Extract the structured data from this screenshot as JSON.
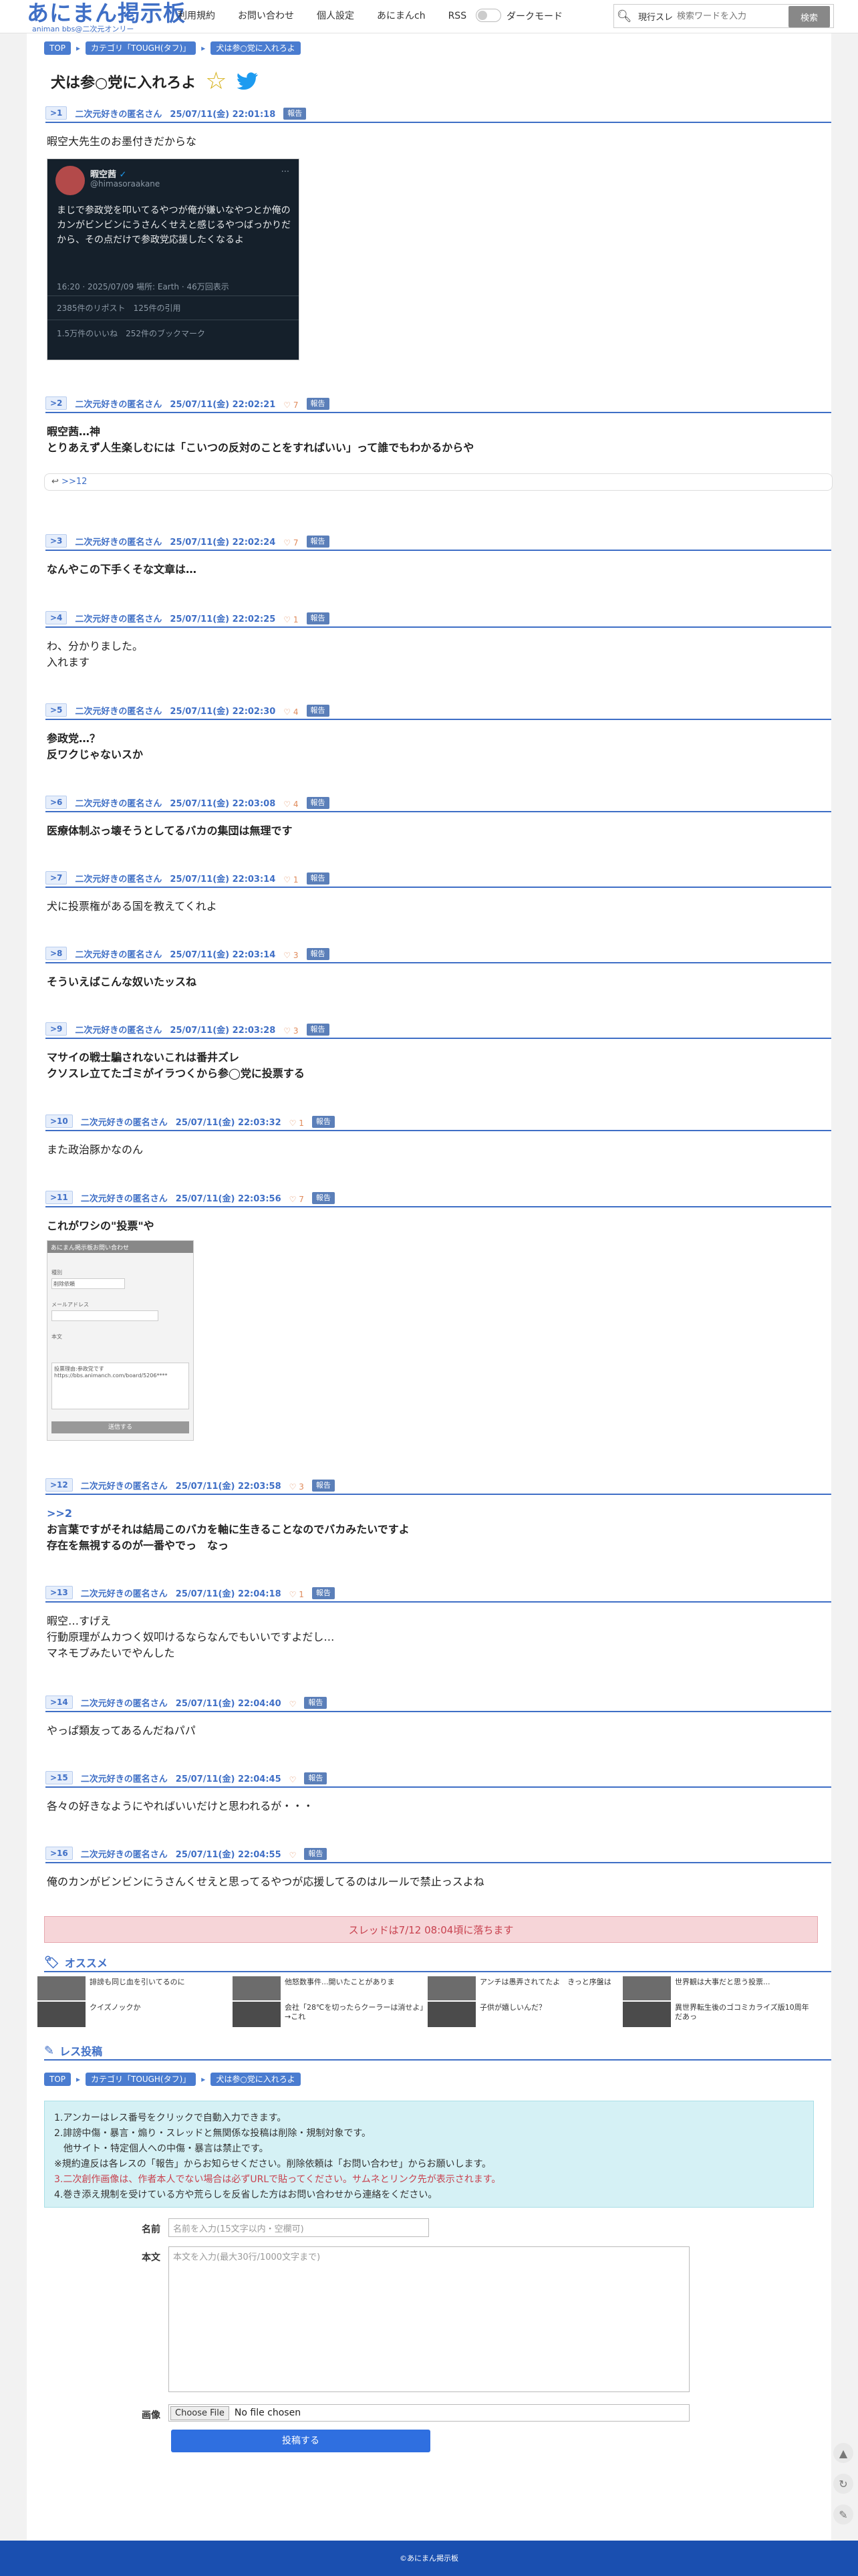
{
  "header": {
    "logo_main": "あにまん掲示板",
    "logo_sub": "animan bbs@二次元オンリー",
    "nav": [
      "利用規約",
      "お問い合わせ",
      "個人設定",
      "あにまんch",
      "RSS"
    ],
    "dark_mode": "ダークモード",
    "search_select": "現行スレ",
    "search_placeholder": "検索ワードを入力",
    "search_button": "検索"
  },
  "breadcrumb": {
    "top": "TOP",
    "category": "カテゴリ「TOUGH(タフ)」",
    "thread": "犬は参○党に入れろよ"
  },
  "thread_title": "犬は参○党に入れろよ",
  "report_label": "報告",
  "posts": [
    {
      "no": ">1",
      "name": "二次元好きの匿名さん",
      "date": "25/07/11(金) 22:01:18",
      "likes": "",
      "lines": [
        "暇空大先生のお墨付きだからな"
      ]
    },
    {
      "no": ">2",
      "name": "二次元好きの匿名さん",
      "date": "25/07/11(金) 22:02:21",
      "likes": "7",
      "lines": [
        "暇空茜…神",
        "とりあえず人生楽しむには「こいつの反対のことをすればいい」って誰でもわかるからや"
      ]
    },
    {
      "no": ">3",
      "name": "二次元好きの匿名さん",
      "date": "25/07/11(金) 22:02:24",
      "likes": "7",
      "lines": [
        "なんやこの下手くそな文章は…"
      ]
    },
    {
      "no": ">4",
      "name": "二次元好きの匿名さん",
      "date": "25/07/11(金) 22:02:25",
      "likes": "1",
      "lines": [
        "わ、分かりました。",
        "入れます"
      ]
    },
    {
      "no": ">5",
      "name": "二次元好きの匿名さん",
      "date": "25/07/11(金) 22:02:30",
      "likes": "4",
      "lines": [
        "参政党…？",
        "反ワクじゃないスか"
      ]
    },
    {
      "no": ">6",
      "name": "二次元好きの匿名さん",
      "date": "25/07/11(金) 22:03:08",
      "likes": "4",
      "lines": [
        "医療体制ぶっ壊そうとしてるバカの集団は無理です"
      ]
    },
    {
      "no": ">7",
      "name": "二次元好きの匿名さん",
      "date": "25/07/11(金) 22:03:14",
      "likes": "1",
      "lines": [
        "犬に投票権がある国を教えてくれよ"
      ]
    },
    {
      "no": ">8",
      "name": "二次元好きの匿名さん",
      "date": "25/07/11(金) 22:03:14",
      "likes": "3",
      "lines": [
        "そういえばこんな奴いたッスね"
      ]
    },
    {
      "no": ">9",
      "name": "二次元好きの匿名さん",
      "date": "25/07/11(金) 22:03:28",
      "likes": "3",
      "lines": [
        "マサイの戦士騙されないこれは番井ズレ",
        "クソスレ立てたゴミがイラつくから参◯党に投票する"
      ]
    },
    {
      "no": ">10",
      "name": "二次元好きの匿名さん",
      "date": "25/07/11(金) 22:03:32",
      "likes": "1",
      "lines": [
        "また政治豚かなのん"
      ]
    },
    {
      "no": ">11",
      "name": "二次元好きの匿名さん",
      "date": "25/07/11(金) 22:03:56",
      "likes": "7",
      "lines": [
        "これがワシの\"投票\"や"
      ]
    },
    {
      "no": ">12",
      "name": "二次元好きの匿名さん",
      "date": "25/07/11(金) 22:03:58",
      "likes": "3",
      "lines": [
        ">>2",
        "お言葉ですがそれは結局このバカを軸に生きることなのでバカみたいですよ",
        "存在を無視するのが一番やでっ　なっ"
      ]
    },
    {
      "no": ">13",
      "name": "二次元好きの匿名さん",
      "date": "25/07/11(金) 22:04:18",
      "likes": "1",
      "lines": [
        "暇空…すげえ",
        "行動原理がムカつく奴叩けるならなんでもいいですよだし…",
        "マネモブみたいでやんした"
      ]
    },
    {
      "no": ">14",
      "name": "二次元好きの匿名さん",
      "date": "25/07/11(金) 22:04:40",
      "likes": "",
      "lines": [
        "やっぱ類友ってあるんだねパパ"
      ]
    },
    {
      "no": ">15",
      "name": "二次元好きの匿名さん",
      "date": "25/07/11(金) 22:04:45",
      "likes": "",
      "lines": [
        "各々の好きなようにやればいいだけと思われるが・・・"
      ]
    },
    {
      "no": ">16",
      "name": "二次元好きの匿名さん",
      "date": "25/07/11(金) 22:04:55",
      "likes": "",
      "lines": [
        "俺のカンがビンビンにうさんくせえと思ってるやつが応援してるのはルールで禁止っスよね"
      ]
    }
  ],
  "reply_link": ">>12",
  "tweet": {
    "name": "暇空茜",
    "handle": "@himasoraakane",
    "text": "まじで参政党を叩いてるやつが俺が嫌いなやつとか俺のカンがビンビンにうさんくせえと感じるやつばっかりだから、その点だけで参政党応援したくなるよ",
    "meta": "16:20 · 2025/07/09 場所: Earth · 46万回表示",
    "reposts": "2385件のリポスト",
    "quotes": "125件の引用",
    "likes": "1.5万件のいいね",
    "bookmarks": "252件のブックマーク"
  },
  "form_image": {
    "title": "あにまん掲示板お問い合わせ",
    "type": "種別",
    "type_value": "削除依頼",
    "mail": "メールアドレス",
    "body": "本文",
    "body_text": "投票理由:参政党です",
    "url": "https://bbs.animanch.com/board/5206****",
    "send": "送信する"
  },
  "drop_notice": "スレッドは7/12 08:04頃に落ちます",
  "recommend": {
    "title": "オススメ",
    "items": [
      {
        "text": "誹謗も同じ血を引いてるのに",
        "sub": "クイズノックか"
      },
      {
        "text": "他怒数事件...開いたことがありま",
        "sub": "会社「28℃を切ったらクーラーは消せよ」→これ"
      },
      {
        "text": "アンチは愚弄されてたよ　きっと序盤は",
        "sub": "子供が嬉しいんだ？"
      },
      {
        "text": "世界観は大事だと思う投票...",
        "sub": "異世界転生後のゴコミカライズ版10周年だあっ"
      }
    ]
  },
  "post_form": {
    "title": "レス投稿",
    "rules": [
      "1.アンカーはレス番号をクリックで自動入力できます。",
      "2.誹謗中傷・暴言・煽り・スレッドと無関係な投稿は削除・規制対象です。",
      "　他サイト・特定個人への中傷・暴言は禁止です。",
      "※規約違反は各レスの「報告」からお知らせください。削除依頼は「お問い合わせ」からお願いします。",
      "3.二次創作画像は、作者本人でない場合は必ずURLで貼ってください。サムネとリンク先が表示されます。",
      "4.巻き添え規制を受けている方や荒らしを反省した方はお問い合わせから連絡をください。"
    ],
    "name_label": "名前",
    "name_placeholder": "名前を入力(15文字以内・空欄可)",
    "body_label": "本文",
    "body_placeholder": "本文を入力(最大30行/1000文字まで)",
    "image_label": "画像",
    "choose_file": "Choose File",
    "no_file": "No file chosen",
    "submit": "投稿する"
  },
  "footer": "©あにまん掲示板",
  "colors": {
    "accent": "#3f6fc6",
    "report": "#5b7fb9",
    "notice_bg": "#f6d5d8",
    "rules_bg": "#d5f1f5",
    "footer": "#1a4fb0"
  }
}
